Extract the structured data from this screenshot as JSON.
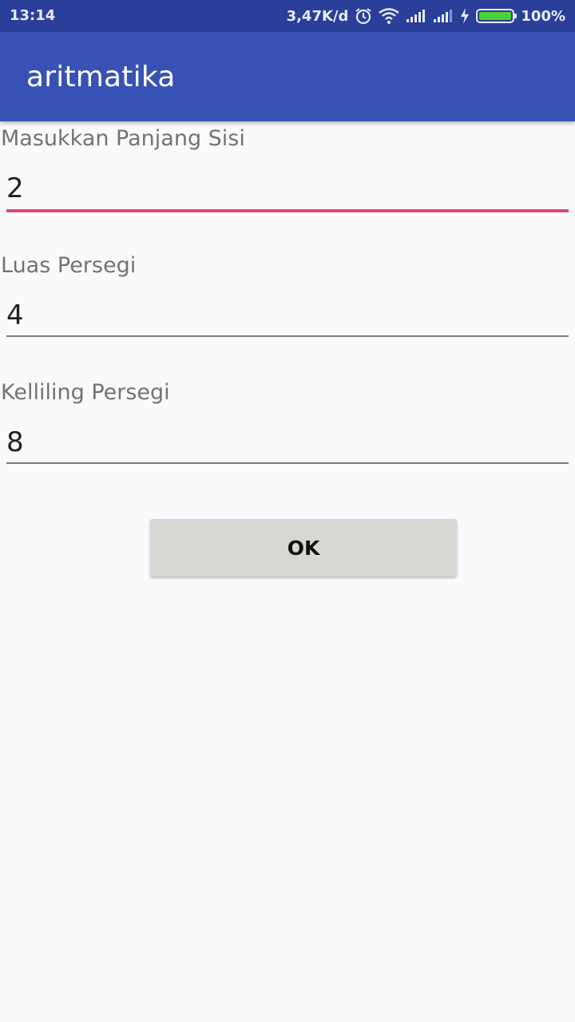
{
  "status_bar": {
    "time": "13:14",
    "network_speed": "3,47K/d",
    "battery_percent": "100%",
    "battery_level": 1.0,
    "icons": [
      "alarm-icon",
      "wifi-icon",
      "signal-icon",
      "signal-icon",
      "charging-icon",
      "battery-icon"
    ]
  },
  "app_bar": {
    "title": "aritmatika"
  },
  "form": {
    "side_label": "Masukkan Panjang Sisi",
    "side_value": "2",
    "area_label": "Luas Persegi",
    "area_value": "4",
    "perimeter_label": "Kelliling Persegi",
    "perimeter_value": "8",
    "ok_label": "OK"
  },
  "colors": {
    "status_bar": "#2a3f9a",
    "app_bar": "#3851b4",
    "focus_accent": "#e5467a",
    "button": "#d6d8d4"
  }
}
